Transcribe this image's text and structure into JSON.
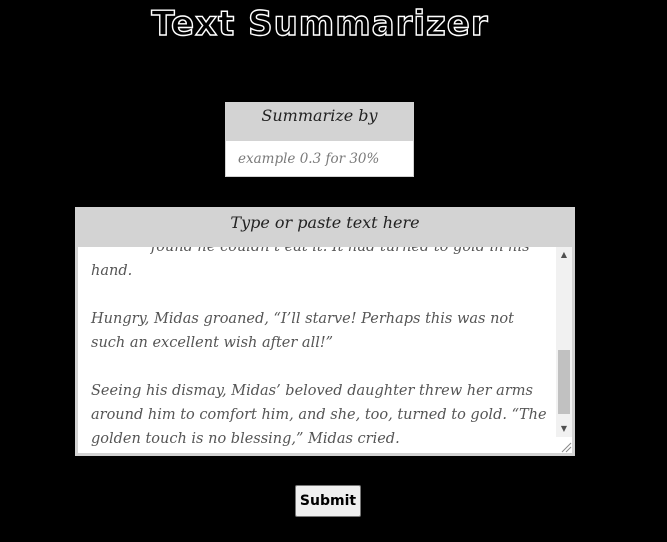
{
  "header": {
    "title": "Text Summarizer"
  },
  "ratio": {
    "label": "Summarize by",
    "placeholder": "example 0.3 for 30%"
  },
  "text_input": {
    "label": "Type or paste text here",
    "value": "             found he couldn’t eat it. It had turned to gold in his hand.\n\nHungry, Midas groaned, “I’ll starve! Perhaps this was not such an excellent wish after all!”\n\nSeeing his dismay, Midas’ beloved daughter threw her arms around him to comfort him, and she, too, turned to gold. “The golden touch is no blessing,” Midas cried."
  },
  "scrollbar": {
    "up_icon": "triangle-up",
    "down_icon": "triangle-down",
    "position": 0.85
  },
  "submit": {
    "label": "Submit"
  }
}
